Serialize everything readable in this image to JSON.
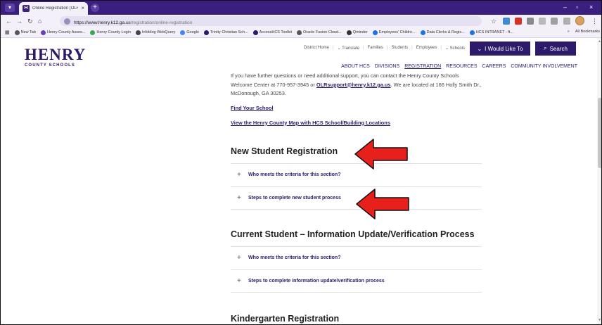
{
  "browser": {
    "tab_title": "Online Registration (OLR) - Ho",
    "tab_favicon": "H",
    "url_base": "https://www.henry.k12.ga.us",
    "url_path": "/registration/online-registration",
    "bookmarks": [
      {
        "label": "New Tab",
        "color": "#555555"
      },
      {
        "label": "Henry County Asses...",
        "color": "#6a3fb5"
      },
      {
        "label": "Henry County Login",
        "color": "#3aa757"
      },
      {
        "label": "Infoblog WebQuery",
        "color": "#444444"
      },
      {
        "label": "Google",
        "color": "#4285f4"
      },
      {
        "label": "Trinity Christian Sch...",
        "color": "#2e1a6b"
      },
      {
        "label": "AccessHCS Toolkit",
        "color": "#2e1a6b"
      },
      {
        "label": "Oracle Fusion Cloud...",
        "color": "#555555"
      },
      {
        "label": "Qminder",
        "color": "#333333"
      },
      {
        "label": "Employees' Childre...",
        "color": "#1a73e8"
      },
      {
        "label": "Data Clerks & Regis...",
        "color": "#1a73e8"
      },
      {
        "label": "HCS INTRANET - ft...",
        "color": "#1a73e8"
      }
    ],
    "all_bookmarks": "All Bookmarks",
    "bookmarks_more": "»"
  },
  "site": {
    "logo_big": "HENRY",
    "logo_small": "COUNTY SCHOOLS",
    "utility_nav": [
      "District Home",
      "Translate",
      "Families",
      "Students",
      "Employees",
      "Schools"
    ],
    "i_would_like": "I Would Like To",
    "search": "Search",
    "main_nav": [
      "ABOUT HCS",
      "DIVISIONS",
      "REGISTRATION",
      "RESOURCES",
      "CAREERS",
      "COMMUNITY INVOLVEMENT"
    ]
  },
  "content": {
    "para_before": "If you have further questions or need additional support, you can contact the Henry County Schools Welcome Center at 770-957-3945 or ",
    "para_email": "OLRsupport@henry.k12.ga.us",
    "para_after": ". We are located at 166 Holly Smith Dr., McDonough, GA 30253.",
    "link_find": "Find Your School",
    "link_map": "View the Henry County Map with HCS School/Building Locations",
    "new_student_heading": "New Student Registration",
    "new_student_items": [
      "Who meets the criteria for this section?",
      "Steps to complete new student process"
    ],
    "current_student_heading": "Current Student – Information Update/Verification Process",
    "current_student_items": [
      "Who meets the criteria for this section?",
      "Steps to complete information update/verification process"
    ],
    "kindergarten_heading": "Kindergarten Registration"
  },
  "colors": {
    "brand_purple": "#2e1a6b",
    "annotation_arrow": "#e8201c"
  }
}
